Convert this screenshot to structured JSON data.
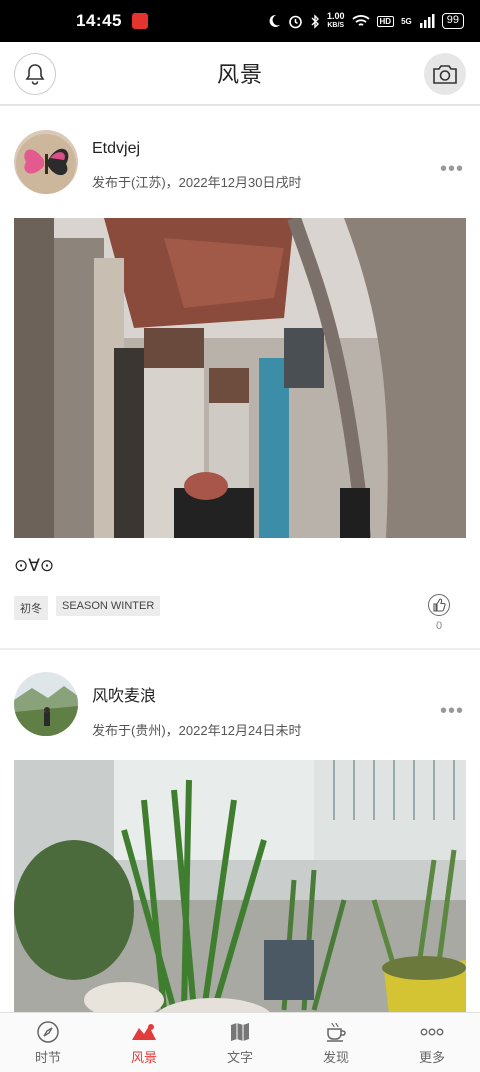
{
  "status": {
    "time": "14:45",
    "net_speed": "1.00",
    "net_unit": "KB/S",
    "hd": "HD",
    "signal": "5G",
    "battery": "99"
  },
  "header": {
    "title": "风景",
    "bell_icon": "bell-icon",
    "camera_icon": "camera-icon"
  },
  "posts": [
    {
      "author": "Etdvjej",
      "posted": "发布于(江苏)，2022年12月30日戌时",
      "caption": "⊙∀⊙",
      "tags": [
        "初冬",
        "SEASON WINTER"
      ],
      "likes": "0",
      "more_label": "•••"
    },
    {
      "author": "风吹麦浪",
      "posted": "发布于(贵州)，2022年12月24日未时",
      "more_label": "•••"
    }
  ],
  "tabs": [
    {
      "label": "时节",
      "icon": "compass-icon"
    },
    {
      "label": "风景",
      "icon": "landscape-icon",
      "active": true
    },
    {
      "label": "文字",
      "icon": "map-icon"
    },
    {
      "label": "发现",
      "icon": "cup-icon"
    },
    {
      "label": "更多",
      "icon": "more-icon"
    }
  ],
  "colors": {
    "accent": "#e23b3b",
    "status_bar": "#000000"
  }
}
